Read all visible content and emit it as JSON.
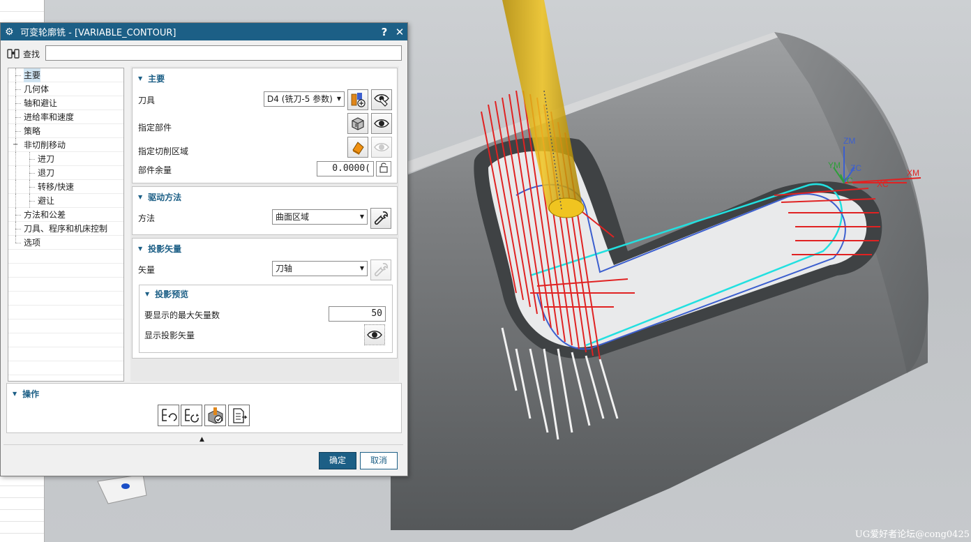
{
  "dialog": {
    "title": "可变轮廓铣 - [VARIABLE_CONTOUR]",
    "help": "?",
    "close": "✕",
    "find_label": "查找",
    "find_value": ""
  },
  "nav": {
    "items": [
      "主要",
      "几何体",
      "轴和避让",
      "进给率和速度",
      "策略",
      "非切削移动",
      "进刀",
      "退刀",
      "转移/快速",
      "避让",
      "方法和公差",
      "刀具、程序和机床控制",
      "选项"
    ],
    "selected": "主要"
  },
  "main": {
    "header": "主要",
    "tool_label": "刀具",
    "tool_value": "D4 (铣刀-5 参数)",
    "part_label": "指定部件",
    "cut_area_label": "指定切削区域",
    "stock_label": "部件余量",
    "stock_value": "0.0000("
  },
  "drive": {
    "header": "驱动方法",
    "method_label": "方法",
    "method_value": "曲面区域"
  },
  "projection": {
    "header": "投影矢量",
    "vector_label": "矢量",
    "vector_value": "刀轴",
    "preview_header": "投影预览",
    "max_vectors_label": "要显示的最大矢量数",
    "max_vectors_value": "50",
    "show_vectors_label": "显示投影矢量"
  },
  "operations": {
    "header": "操作"
  },
  "buttons": {
    "ok": "确定",
    "cancel": "取消"
  },
  "viewport": {
    "axes": [
      "ZM",
      "ZC",
      "YM",
      "YC",
      "XM",
      "XC"
    ],
    "watermark": "UG爱好者论坛@cong0425"
  },
  "icons": [
    "gear-icon",
    "binoculars-icon",
    "tool-create-icon",
    "display-icon",
    "part-select-icon",
    "cut-area-icon",
    "lock-icon",
    "wrench-icon",
    "eye-icon",
    "generate-icon",
    "replay-icon",
    "verify-icon",
    "list-icon"
  ],
  "colors": {
    "titlebar": "#1c5f86",
    "accent": "#1c5f86",
    "toolpath_red": "#e02222",
    "toolpath_blue": "#3c5fcf",
    "toolpath_cyan": "#22e0e0",
    "tool_yellow": "#e6b400"
  }
}
